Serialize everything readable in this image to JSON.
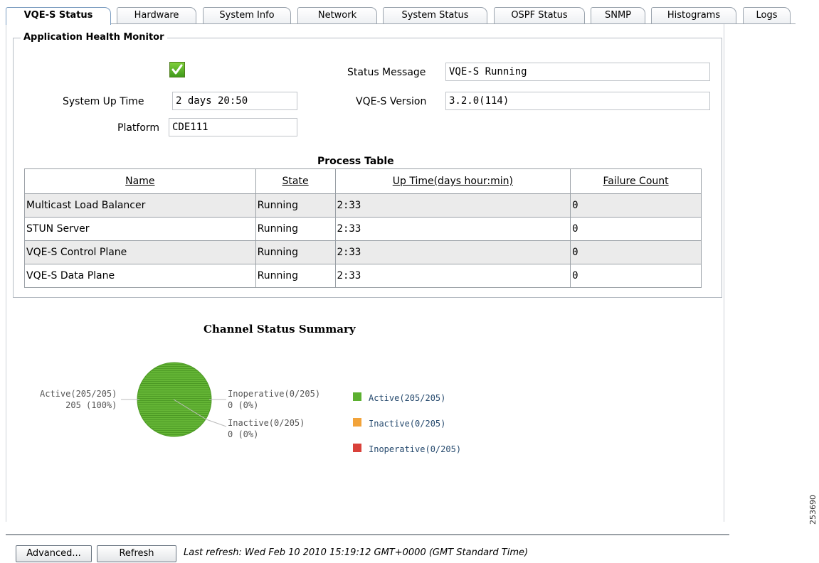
{
  "tabs": [
    {
      "label": "VQE-S Status",
      "active": true
    },
    {
      "label": "Hardware"
    },
    {
      "label": "System Info"
    },
    {
      "label": "Network"
    },
    {
      "label": "System Status"
    },
    {
      "label": "OSPF Status"
    },
    {
      "label": "SNMP"
    },
    {
      "label": "Histograms"
    },
    {
      "label": "Logs"
    }
  ],
  "health": {
    "legend": "Application Health Monitor",
    "uptime_label": "System Up Time",
    "uptime_value": "2 days 20:50",
    "platform_label": "Platform",
    "platform_value": "CDE111",
    "status_msg_label": "Status Message",
    "status_msg_value": "VQE-S Running",
    "version_label": "VQE-S Version",
    "version_value": "3.2.0(114)",
    "status_icon": "check-icon"
  },
  "process_table": {
    "title": "Process Table",
    "columns": [
      "Name",
      "State",
      "Up Time(days hour:min)",
      "Failure Count"
    ],
    "rows": [
      [
        "Multicast Load Balancer",
        "Running",
        "2:33",
        "0"
      ],
      [
        "STUN Server",
        "Running",
        "2:33",
        "0"
      ],
      [
        "VQE-S Control Plane",
        "Running",
        "2:33",
        "0"
      ],
      [
        "VQE-S Data Plane",
        "Running",
        "2:33",
        "0"
      ]
    ]
  },
  "chart_data": {
    "type": "pie",
    "title": "Channel Status Summary",
    "slices": [
      {
        "label": "Active(205/205)",
        "value": 205,
        "percent": "205 (100%)",
        "color": "#5cb030"
      },
      {
        "label": "Inoperative(0/205)",
        "value": 0,
        "percent": "0 (0%)",
        "color": "#d9413a"
      },
      {
        "label": "Inactive(0/205)",
        "value": 0,
        "percent": "0 (0%)",
        "color": "#f2a33a"
      }
    ],
    "legend": [
      {
        "label": "Active(205/205)",
        "color": "#5cb030"
      },
      {
        "label": "Inactive(0/205)",
        "color": "#f2a33a"
      },
      {
        "label": "Inoperative(0/205)",
        "color": "#d9413a"
      }
    ],
    "legend_placement": "right"
  },
  "footer": {
    "advanced_label": "Advanced...",
    "refresh_label": "Refresh",
    "last_refresh": "Last refresh: Wed Feb 10 2010 15:19:12 GMT+0000 (GMT Standard Time)"
  },
  "side_id": "253690"
}
